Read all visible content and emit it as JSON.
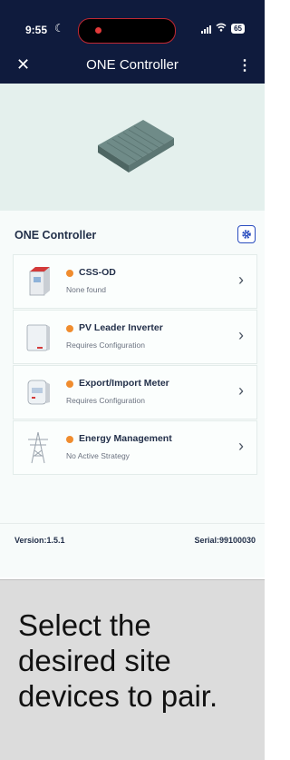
{
  "status_bar": {
    "time": "9:55",
    "battery": "65"
  },
  "app_bar": {
    "title": "ONE Controller"
  },
  "section": {
    "title": "ONE Controller"
  },
  "devices": [
    {
      "name": "CSS-OD",
      "status": "None found",
      "icon": "css-od-cabinet-icon"
    },
    {
      "name": "PV Leader Inverter",
      "status": "Requires Configuration",
      "icon": "inverter-icon"
    },
    {
      "name": "Export/Import Meter",
      "status": "Requires Configuration",
      "icon": "meter-icon"
    },
    {
      "name": "Energy Management",
      "status": "No Active Strategy",
      "icon": "power-tower-icon"
    }
  ],
  "footer": {
    "version": "Version:1.5.1",
    "serial": "Serial:99100030"
  },
  "caption": "Select the desired site devices to pair.",
  "colors": {
    "header": "#0f1b3d",
    "warning": "#f08c2e",
    "accent": "#2a4dbf",
    "hero_bg": "#e4f0ed"
  }
}
